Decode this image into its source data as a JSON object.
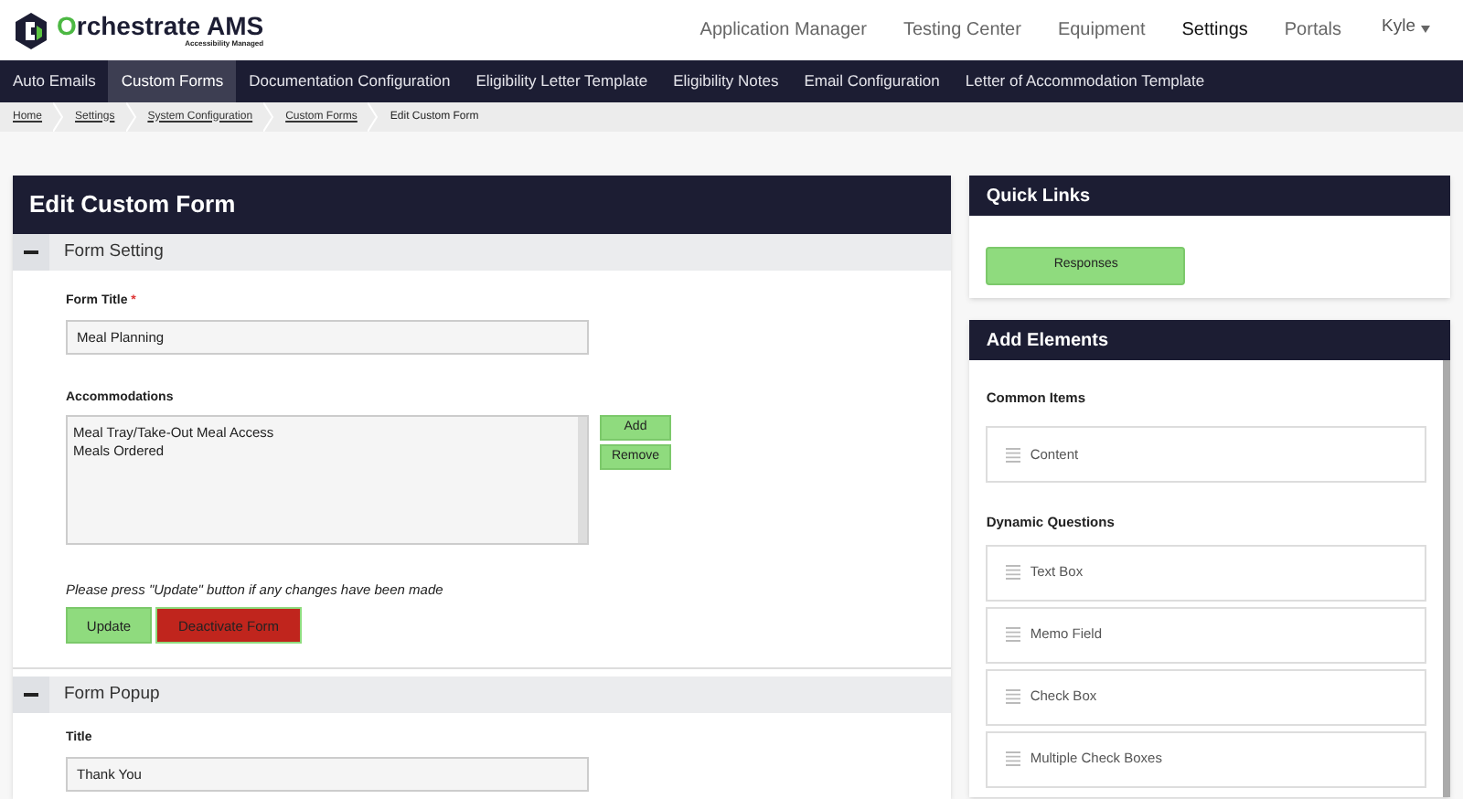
{
  "brand": {
    "name_prefix": "O",
    "name_rest": "rchestrate AMS",
    "tagline": "Accessibility Managed"
  },
  "top_nav": [
    {
      "label": "Application Manager",
      "selected": false
    },
    {
      "label": "Testing Center",
      "selected": false
    },
    {
      "label": "Equipment",
      "selected": false
    },
    {
      "label": "Settings",
      "selected": true
    },
    {
      "label": "Portals",
      "selected": false
    }
  ],
  "user_menu": {
    "label": "Kyle"
  },
  "sub_nav": [
    {
      "label": "Auto Emails",
      "selected": false
    },
    {
      "label": "Custom Forms",
      "selected": true
    },
    {
      "label": "Documentation Configuration",
      "selected": false
    },
    {
      "label": "Eligibility Letter Template",
      "selected": false
    },
    {
      "label": "Eligibility Notes",
      "selected": false
    },
    {
      "label": "Email Configuration",
      "selected": false
    },
    {
      "label": "Letter of Accommodation Template",
      "selected": false
    }
  ],
  "breadcrumbs": [
    {
      "label": "Home",
      "link": true
    },
    {
      "label": "Settings",
      "link": true
    },
    {
      "label": "System Configuration",
      "link": true
    },
    {
      "label": "Custom Forms",
      "link": true
    },
    {
      "label": "Edit Custom Form",
      "link": false
    }
  ],
  "main_panel": {
    "title": "Edit Custom Form",
    "sections": [
      {
        "title": "Form Setting",
        "expanded": true
      },
      {
        "title": "Form Popup",
        "expanded": true
      }
    ],
    "form_title": {
      "label": "Form Title",
      "required_mark": "*",
      "value": "Meal Planning"
    },
    "accommodations": {
      "label": "Accommodations",
      "items": [
        "Meal Tray/Take-Out Meal Access",
        "Meals Ordered"
      ],
      "buttons": [
        "Add",
        "Remove"
      ]
    },
    "note": "Please press \"Update\" button if any changes have been made",
    "buttons": [
      {
        "label": "Update",
        "kind": "primary"
      },
      {
        "label": "Deactivate Form",
        "kind": "danger"
      }
    ],
    "popup_title": {
      "label": "Title",
      "value": "Thank You"
    }
  },
  "quick_links": {
    "title": "Quick Links",
    "buttons": [
      "Responses"
    ]
  },
  "add_elements": {
    "title": "Add Elements",
    "groups": [
      {
        "title": "Common Items",
        "items": [
          "Content"
        ]
      },
      {
        "title": "Dynamic Questions",
        "items": [
          "Text Box",
          "Memo Field",
          "Check Box",
          "Multiple Check Boxes"
        ]
      }
    ]
  }
}
